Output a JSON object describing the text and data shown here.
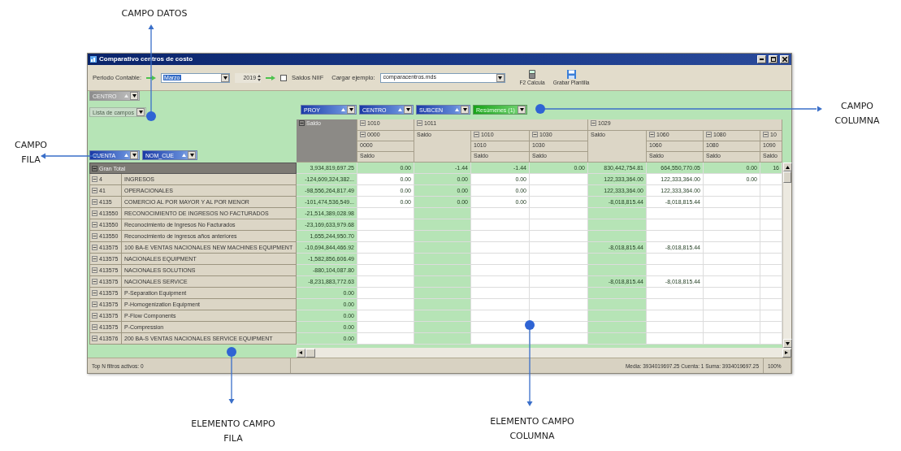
{
  "annotations": [
    {
      "label": "CAMPO DATOS"
    },
    {
      "label": "CAMPO COLUMNA"
    },
    {
      "label": "CAMPO FILA"
    },
    {
      "label": "ELEMENTO CAMPO FILA"
    },
    {
      "label": "ELEMENTO CAMPO COLUMNA"
    }
  ],
  "window": {
    "title": "Comparativo centros de costo"
  },
  "toolbar": {
    "period_label": "Periodo Contable:",
    "month": {
      "value": "Marzo",
      "highlighted": true
    },
    "year": "2019",
    "saldos_niif": {
      "label": "Saldos NIIF",
      "checked": false
    },
    "example_label": "Cargar ejemplo:",
    "example": "comparacentros.mds",
    "buttons": [
      {
        "kind": "calculator",
        "label": "F2 Calcula"
      },
      {
        "kind": "save",
        "label": "Grabar Plantilla"
      }
    ]
  },
  "pivot": {
    "fields": [
      {
        "kind": "filter",
        "label": "CENTRO"
      },
      {
        "kind": "data",
        "label": "Lista de campos"
      },
      {
        "kind": "column",
        "label": "PROY"
      },
      {
        "kind": "column",
        "label": "CENTRO"
      },
      {
        "kind": "column",
        "label": "SUBCEN"
      },
      {
        "kind": "summary",
        "label": "Resúmenes (1)"
      },
      {
        "kind": "row",
        "label": "CUENTA"
      },
      {
        "kind": "row",
        "label": "NOM_CUE"
      }
    ],
    "column_headers": [
      {
        "label": "Saldo",
        "expanded": true
      },
      {
        "label": "1010",
        "expanded": true,
        "children": [
          {
            "label": "0000",
            "expanded": true,
            "children": [
              {
                "label": "0000",
                "children": [
                  {
                    "label": "Saldo"
                  }
                ]
              }
            ]
          }
        ]
      },
      {
        "label": "1011",
        "expanded": true,
        "children": [
          {
            "label": "Saldo"
          },
          {
            "label": "1010",
            "expanded": true,
            "children": [
              {
                "label": "1010",
                "children": [
                  {
                    "label": "Saldo"
                  }
                ]
              }
            ]
          },
          {
            "label": "1030",
            "expanded": true,
            "children": [
              {
                "label": "1030",
                "children": [
                  {
                    "label": "Saldo"
                  }
                ]
              }
            ]
          }
        ]
      },
      {
        "label": "1029",
        "expanded": true,
        "children": [
          {
            "label": "Saldo"
          },
          {
            "label": "1060",
            "expanded": true,
            "children": [
              {
                "label": "1060",
                "children": [
                  {
                    "label": "Saldo"
                  }
                ]
              }
            ]
          },
          {
            "label": "1080",
            "expanded": true,
            "children": [
              {
                "label": "1080",
                "children": [
                  {
                    "label": "Saldo"
                  }
                ]
              }
            ]
          },
          {
            "label": "10",
            "expanded": true,
            "children": [
              {
                "label": "1090",
                "children": [
                  {
                    "label": "Saldo"
                  }
                ]
              }
            ]
          }
        ]
      }
    ],
    "rows": [
      {
        "kind": "total",
        "label": "Gran Total",
        "expanded": true,
        "values": {
          "column_1": "3,934,819,697.25",
          "column_2": "0.00",
          "column_3": "-1.44",
          "column_4": "-1.44",
          "column_5": "0.00",
          "column_6": "830,442,754.81",
          "column_7": "664,550,770.05",
          "column_8": "0.00",
          "column_9": "16"
        }
      },
      {
        "kind": "account",
        "code": "4",
        "name": "INGRESOS",
        "expanded": true,
        "values": {
          "column_1": "-124,609,324,382...",
          "column_2": "0.00",
          "column_3": "0.00",
          "column_4": "0.00",
          "column_6": "122,333,364.00",
          "column_7": "122,333,364.00",
          "column_8": "0.00"
        }
      },
      {
        "kind": "account",
        "code": "41",
        "name": "OPERACIONALES",
        "expanded": true,
        "values": {
          "column_1": "-98,556,264,817.49",
          "column_2": "0.00",
          "column_3": "0.00",
          "column_4": "0.00",
          "column_6": "122,333,364.00",
          "column_7": "122,333,364.00"
        }
      },
      {
        "kind": "account",
        "code": "4135",
        "name": "COMERCIO AL POR MAYOR Y AL POR MENOR",
        "expanded": true,
        "values": {
          "column_1": "-101,474,536,549...",
          "column_2": "0.00",
          "column_3": "0.00",
          "column_4": "0.00",
          "column_6": "-8,018,815.44",
          "column_7": "-8,018,815.44"
        }
      },
      {
        "kind": "account",
        "code": "413550",
        "name": "RECONOCIMIENTO DE INGRESOS NO FACTURADOS",
        "expanded": true,
        "values": {
          "column_1": "-21,514,389,028.98"
        }
      },
      {
        "kind": "account",
        "code": "413550",
        "name": "Reconocimiento de Ingresos No Facturados",
        "expanded": true,
        "values": {
          "column_1": "-23,169,633,979.68"
        }
      },
      {
        "kind": "account",
        "code": "413550",
        "name": "Reconocimiento de ingresos años anteriores",
        "expanded": true,
        "values": {
          "column_1": "1,655,244,950.70"
        }
      },
      {
        "kind": "account",
        "code": "413575",
        "name": "100 BA-E VENTAS  NACIONALES NEW MACHINES EQUIPMENT",
        "expanded": true,
        "values": {
          "column_1": "-10,694,844,466.92",
          "column_6": "-8,018,815.44",
          "column_7": "-8,018,815.44"
        }
      },
      {
        "kind": "account",
        "code": "413575",
        "name": "NACIONALES EQUIPMENT",
        "expanded": true,
        "values": {
          "column_1": "-1,582,856,606.49"
        }
      },
      {
        "kind": "account",
        "code": "413575",
        "name": "NACIONALES SOLUTIONS",
        "expanded": true,
        "values": {
          "column_1": "-880,104,087.80"
        }
      },
      {
        "kind": "account",
        "code": "413575",
        "name": "NACIONALES SERVICE",
        "expanded": true,
        "values": {
          "column_1": "-8,231,883,772.63",
          "column_6": "-8,018,815.44",
          "column_7": "-8,018,815.44"
        }
      },
      {
        "kind": "account",
        "code": "413575",
        "name": "P-Separation Equipment",
        "expanded": true,
        "values": {
          "column_1": "0.00"
        }
      },
      {
        "kind": "account",
        "code": "413575",
        "name": "P-Homogenization Equipment",
        "expanded": true,
        "values": {
          "column_1": "0.00"
        }
      },
      {
        "kind": "account",
        "code": "413575",
        "name": "P-Flow Components",
        "expanded": true,
        "values": {
          "column_1": "0.00"
        }
      },
      {
        "kind": "account",
        "code": "413575",
        "name": "P-Compression",
        "expanded": true,
        "values": {
          "column_1": "0.00"
        }
      },
      {
        "kind": "account",
        "code": "413576",
        "name": "200 BA-S  VENTAS  NACIONALES SERVICE EQUIPMENT",
        "expanded": true,
        "values": {
          "column_1": "0.00"
        }
      }
    ]
  },
  "status_bar": {
    "filters": "Top N filtros activos: 0",
    "summary": "Media: 3934019697.25 Cuenta: 1 Suma: 3934019697.25",
    "zoom": "100%"
  }
}
